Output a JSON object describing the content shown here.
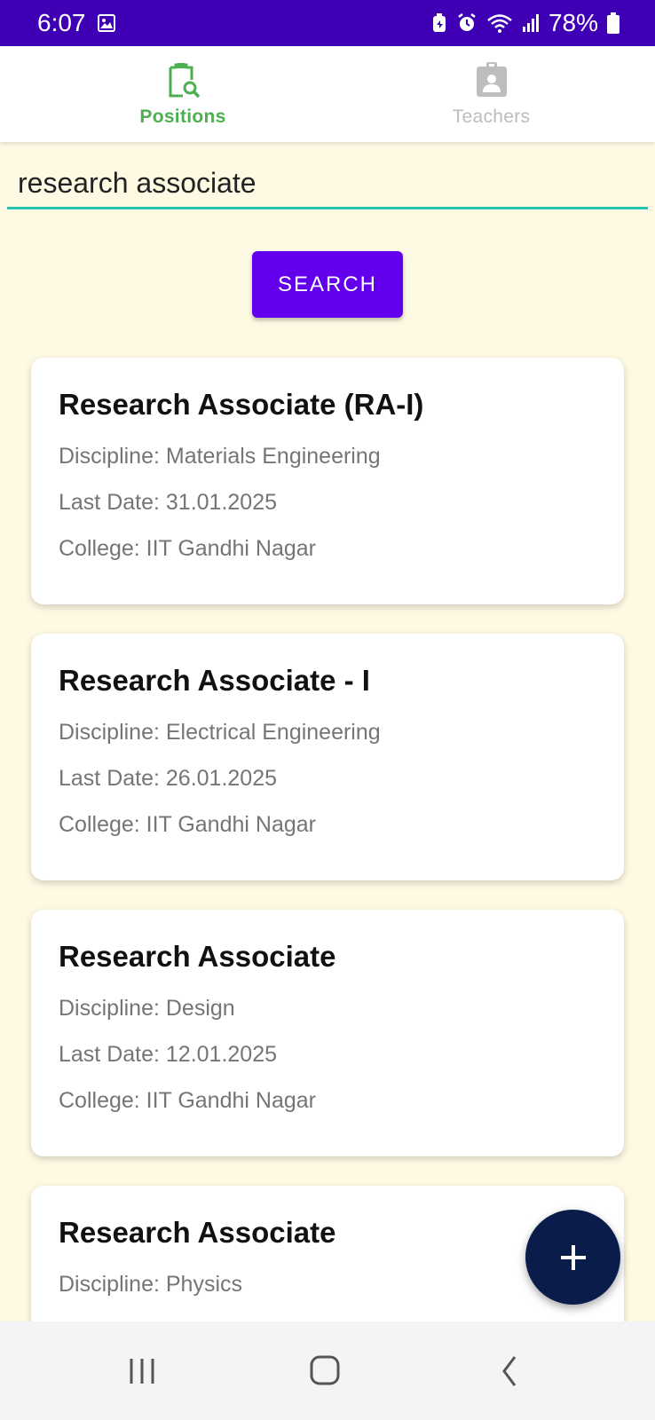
{
  "status_bar": {
    "time": "6:07",
    "battery_percent": "78%"
  },
  "tabs": [
    {
      "label": "Positions",
      "icon": "clipboard-search-icon",
      "selected": true,
      "color": "#4caf50"
    },
    {
      "label": "Teachers",
      "icon": "contact-badge-icon",
      "selected": false,
      "color": "#bdbdbd"
    }
  ],
  "search": {
    "value": "research associate",
    "button_label": "SEARCH"
  },
  "positions": [
    {
      "title": "Research Associate (RA-I)",
      "discipline": "Discipline: Materials Engineering",
      "last_date": "Last Date: 31.01.2025",
      "college": "College: IIT Gandhi Nagar"
    },
    {
      "title": "Research Associate - I",
      "discipline": "Discipline: Electrical Engineering",
      "last_date": "Last Date: 26.01.2025",
      "college": "College: IIT Gandhi Nagar"
    },
    {
      "title": "Research Associate",
      "discipline": "Discipline: Design",
      "last_date": "Last Date: 12.01.2025",
      "college": "College: IIT Gandhi Nagar"
    },
    {
      "title": "Research Associate",
      "discipline": "Discipline: Physics"
    }
  ],
  "fab": {
    "icon": "plus-icon"
  },
  "colors": {
    "status_bar": "#3f00b5",
    "accent": "#6200ee",
    "background": "#fdf9e3",
    "fab": "#0a1d4a",
    "input_underline": "#26c6b3"
  }
}
